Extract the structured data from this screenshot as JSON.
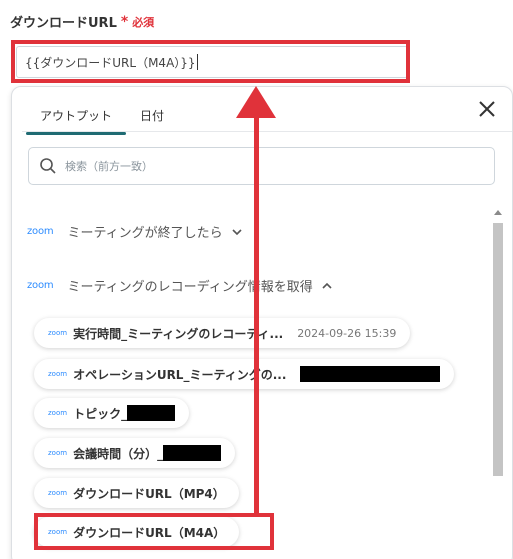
{
  "field": {
    "label": "ダウンロードURL",
    "required_mark": "*",
    "required_text": "必須",
    "value": "{{ダウンロードURL（M4A）}}"
  },
  "panel": {
    "tabs": [
      {
        "label": "アウトプット",
        "active": true
      },
      {
        "label": "日付",
        "active": false
      }
    ],
    "search_placeholder": "検索（前方一致）",
    "groups": [
      {
        "logo": "zoom",
        "label": "ミーティングが終了したら",
        "expanded": false
      },
      {
        "logo": "zoom",
        "label": "ミーティングのレコーディング情報を取得",
        "expanded": true
      }
    ],
    "items": [
      {
        "logo": "zoom",
        "label": "実行時間_ミーティングのレコーディ...",
        "meta": "2024-09-26 15:39"
      },
      {
        "logo": "zoom",
        "label": "オペレーションURL_ミーティングの...",
        "meta": ""
      },
      {
        "logo": "zoom",
        "label": "トピック_",
        "meta": ""
      },
      {
        "logo": "zoom",
        "label": "会議時間（分）_",
        "meta": ""
      },
      {
        "logo": "zoom",
        "label": "ダウンロードURL（MP4）",
        "meta": ""
      },
      {
        "logo": "zoom",
        "label": "ダウンロードURL（M4A）",
        "meta": ""
      }
    ]
  },
  "colors": {
    "highlight": "#e0323a",
    "zoom_blue": "#2d8cff",
    "tab_underline": "#1f6b73"
  },
  "icons": {
    "close": "close-icon",
    "search": "search-icon",
    "chevron_down": "chevron-down-icon",
    "chevron_up": "chevron-up-icon"
  }
}
